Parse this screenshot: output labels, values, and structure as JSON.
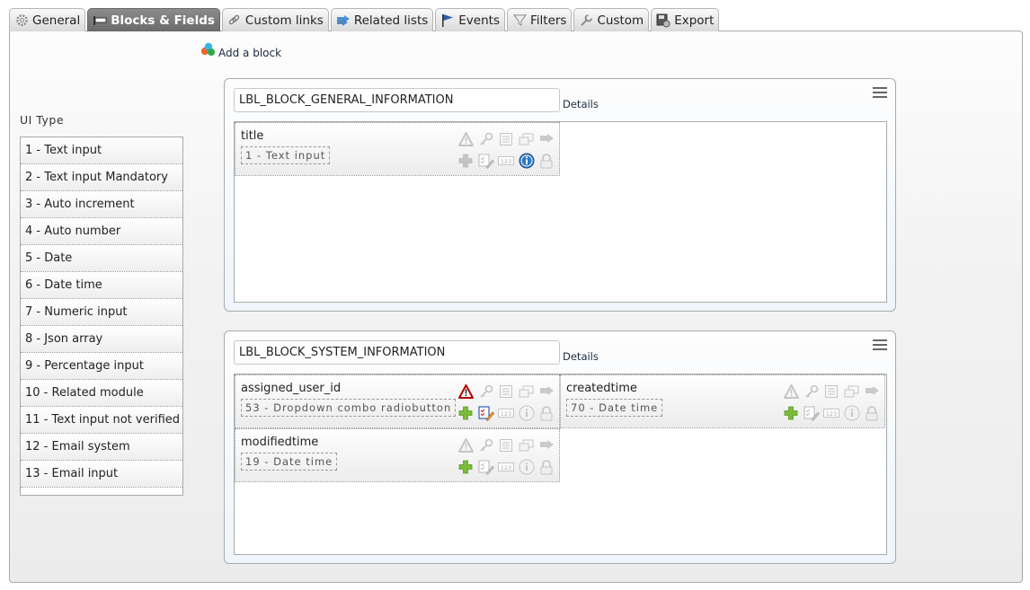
{
  "tabs": [
    {
      "label": "General",
      "icon": "gear-icon",
      "active": false
    },
    {
      "label": "Blocks & Fields",
      "icon": "blocks-icon",
      "active": true
    },
    {
      "label": "Custom links",
      "icon": "link-icon",
      "active": false
    },
    {
      "label": "Related lists",
      "icon": "related-arrows-icon",
      "active": false
    },
    {
      "label": "Events",
      "icon": "flag-icon",
      "active": false
    },
    {
      "label": "Filters",
      "icon": "filter-icon",
      "active": false
    },
    {
      "label": "Custom",
      "icon": "wrench-icon",
      "active": false
    },
    {
      "label": "Export",
      "icon": "export-icon",
      "active": false
    }
  ],
  "add_block": {
    "label": "Add a block"
  },
  "ui_types": {
    "label": "UI Type",
    "items": [
      "1 - Text input",
      "2 - Text input Mandatory",
      "3 - Auto increment",
      "4 - Auto number",
      "5 - Date",
      "6 - Date time",
      "7 - Numeric input",
      "8 - Json array",
      "9 - Percentage input",
      "10 - Related module",
      "11 - Text input not verified",
      "12 - Email system",
      "13 - Email input"
    ]
  },
  "blocks": [
    {
      "name": "LBL_BLOCK_GENERAL_INFORMATION",
      "details_label": "Details",
      "fields": [
        {
          "name": "title",
          "type": "1 - Text input",
          "mandatory": false,
          "quickcreate": false,
          "massedit": false,
          "info": true
        }
      ]
    },
    {
      "name": "LBL_BLOCK_SYSTEM_INFORMATION",
      "details_label": "Details",
      "fields": [
        {
          "name": "assigned_user_id",
          "type": "53 - Dropdown combo radiobutton",
          "mandatory": true,
          "quickcreate": true,
          "massedit": true,
          "info": false
        },
        {
          "name": "createdtime",
          "type": "70 - Date time",
          "mandatory": false,
          "quickcreate": true,
          "massedit": false,
          "info": false
        },
        {
          "name": "modifiedtime",
          "type": "19 - Date time",
          "mandatory": false,
          "quickcreate": true,
          "massedit": false,
          "info": false
        }
      ]
    }
  ],
  "colors": {
    "active_tab": "#7a7a7a",
    "mandatory_red": "#b00000",
    "quickcreate_green": "#7cbb3a",
    "info_blue": "#2f78c4",
    "block_bg": "#eef5fc"
  }
}
